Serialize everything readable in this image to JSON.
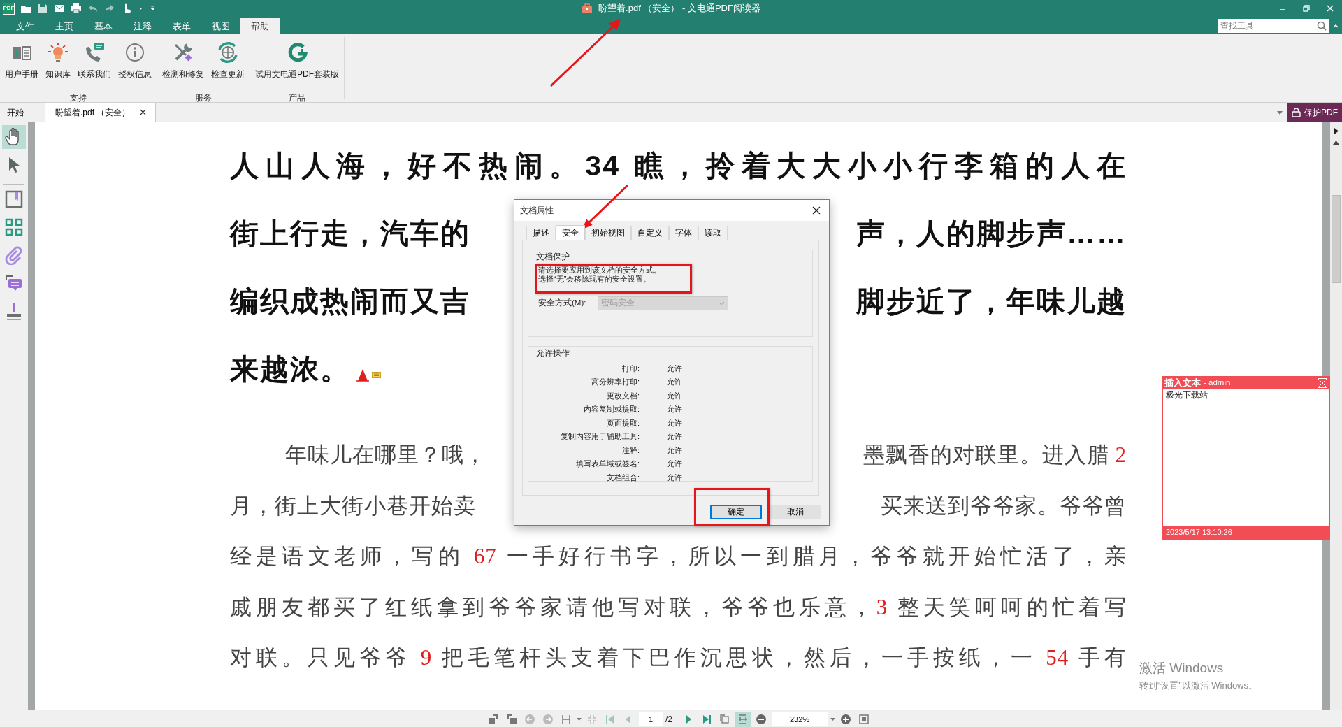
{
  "window": {
    "app_logo": "PDF",
    "title": "盼望着.pdf （安全） - 文电通PDF阅读器"
  },
  "menu_tabs": [
    {
      "label": "文件",
      "selected": false
    },
    {
      "label": "主页",
      "selected": false
    },
    {
      "label": "基本",
      "selected": false
    },
    {
      "label": "注释",
      "selected": false
    },
    {
      "label": "表单",
      "selected": false
    },
    {
      "label": "视图",
      "selected": false
    },
    {
      "label": "帮助",
      "selected": true
    }
  ],
  "search": {
    "placeholder": "查找工具"
  },
  "ribbon_groups": [
    {
      "label": "支持",
      "buttons": [
        {
          "label": "用户手册",
          "kind": "manual"
        },
        {
          "label": "知识库",
          "kind": "knowledge"
        },
        {
          "label": "联系我们",
          "kind": "contact"
        },
        {
          "label": "授权信息",
          "kind": "license"
        }
      ]
    },
    {
      "label": "服务",
      "buttons": [
        {
          "label": "检测和修复",
          "kind": "repair"
        },
        {
          "label": "检查更新",
          "kind": "update"
        }
      ]
    },
    {
      "label": "产品",
      "buttons": [
        {
          "label": "试用文电通PDF套装版",
          "kind": "trial"
        }
      ]
    }
  ],
  "document_tabs": [
    {
      "label": "开始",
      "selected": false,
      "closable": false
    },
    {
      "label": "盼望着.pdf （安全）",
      "selected": true,
      "closable": true
    }
  ],
  "protect_button": "保护PDF",
  "sidebar_tools": [
    {
      "kind": "hand",
      "selected": true
    },
    {
      "kind": "pointer",
      "selected": false
    },
    {
      "kind": "bookmark",
      "selected": false
    },
    {
      "kind": "thumbnails",
      "selected": false
    },
    {
      "kind": "attachment",
      "selected": false
    },
    {
      "kind": "comments",
      "selected": false
    },
    {
      "kind": "stamp",
      "selected": false
    }
  ],
  "document": {
    "heading_lines": [
      {
        "annotated": false,
        "parts": [
          [
            {
              "text": "人山人海，好不热闹。34 瞧，拎着大大小小行李箱的人在",
              "kind": "text"
            }
          ]
        ]
      },
      {
        "annotated": false,
        "parts": [
          [
            {
              "text": "街上行走，汽车的",
              "kind": "text"
            }
          ],
          [
            {
              "text": "声，人的脚步声……",
              "kind": "text"
            }
          ]
        ]
      },
      {
        "annotated": false,
        "parts": [
          [
            {
              "text": "编织成热闹而又吉",
              "kind": "text"
            }
          ],
          [
            {
              "text": "脚步近了，年味儿越",
              "kind": "text"
            }
          ]
        ]
      },
      {
        "annotated": true,
        "parts": [
          [
            {
              "text": "来越浓。",
              "kind": "text"
            }
          ]
        ]
      }
    ],
    "body_lines": [
      {
        "indented": true,
        "parts": [
          [
            {
              "text": "年味儿在哪里？哦，",
              "kind": "text"
            }
          ],
          [
            {
              "text": "墨飘香的对联里。进入腊 ",
              "kind": "text"
            },
            {
              "text": "2",
              "kind": "number"
            }
          ]
        ]
      },
      {
        "indented": false,
        "parts": [
          [
            {
              "text": "月，街上大街小巷开始卖",
              "kind": "text"
            }
          ],
          [
            {
              "text": "买来送到爷爷家。爷爷曾",
              "kind": "text"
            }
          ]
        ]
      },
      {
        "indented": false,
        "parts": [
          [
            {
              "text": "经是语文老师，写的 ",
              "kind": "text"
            },
            {
              "text": "67",
              "kind": "number"
            },
            {
              "text": " 一手好行书字，所以一到腊月，爷爷就开始忙活了，亲",
              "kind": "text"
            }
          ]
        ]
      },
      {
        "indented": false,
        "parts": [
          [
            {
              "text": "戚朋友都买了红纸拿到爷爷家请他写对联，爷爷也乐意，",
              "kind": "text"
            },
            {
              "text": "3",
              "kind": "number"
            },
            {
              "text": " 整天笑呵呵的忙着写",
              "kind": "text"
            }
          ]
        ]
      },
      {
        "indented": false,
        "parts": [
          [
            {
              "text": "对联。只见爷爷 ",
              "kind": "text"
            },
            {
              "text": "9",
              "kind": "number"
            },
            {
              "text": " 把毛笔杆头支着下巴作沉思状，然后，一手按纸，一 ",
              "kind": "text"
            },
            {
              "text": "54",
              "kind": "number"
            },
            {
              "text": " 手有",
              "kind": "text"
            }
          ]
        ]
      }
    ]
  },
  "annotation_note": {
    "title": "插入文本",
    "author": "- admin",
    "content": "极光下载站",
    "timestamp": "2023/5/17 13:10:26"
  },
  "dialog": {
    "title": "文档属性",
    "tabs": [
      {
        "label": "描述",
        "selected": false
      },
      {
        "label": "安全",
        "selected": true
      },
      {
        "label": "初始视图",
        "selected": false
      },
      {
        "label": "自定义",
        "selected": false
      },
      {
        "label": "字体",
        "selected": false
      },
      {
        "label": "读取",
        "selected": false
      }
    ],
    "protection": {
      "heading": "文档保护",
      "description": [
        "请选择要应用到该文档的安全方式。",
        "选择“无”会移除现有的安全设置。"
      ],
      "method_label": "安全方式(M):",
      "method_value": "密码安全",
      "method_disabled": true
    },
    "permissions": {
      "heading": "允许操作",
      "rows": [
        {
          "label": "打印:",
          "value": "允许"
        },
        {
          "label": "高分辨率打印:",
          "value": "允许"
        },
        {
          "label": "更改文档:",
          "value": "允许"
        },
        {
          "label": "内容复制或提取:",
          "value": "允许"
        },
        {
          "label": "页面提取:",
          "value": "允许"
        },
        {
          "label": "复制内容用于辅助工具:",
          "value": "允许"
        },
        {
          "label": "注释:",
          "value": "允许"
        },
        {
          "label": "填写表单域或签名:",
          "value": "允许"
        },
        {
          "label": "文档组合:",
          "value": "允许"
        }
      ]
    },
    "buttons": [
      {
        "label": "确定",
        "default": true
      },
      {
        "label": "取消",
        "default": false
      }
    ]
  },
  "bottom_toolbar": {
    "page": "1",
    "page_count": "/2",
    "zoom": "232%",
    "continuous_view": true
  },
  "os_notice": {
    "title": "激活 Windows",
    "text": "转到“设置”以激活 Windows。"
  }
}
